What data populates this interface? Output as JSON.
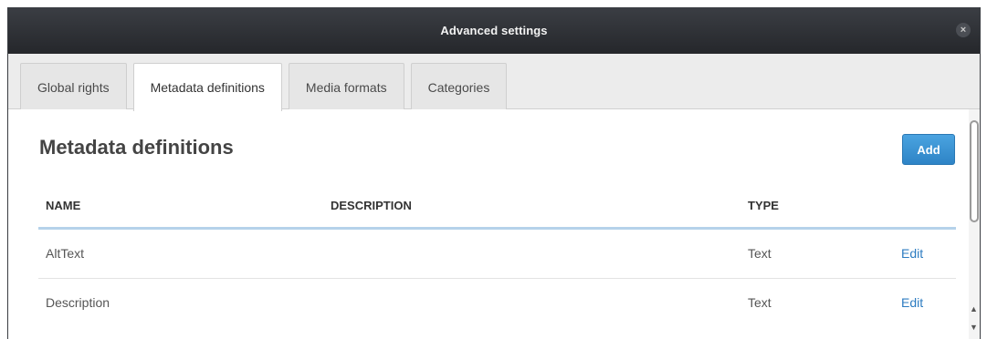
{
  "window": {
    "title": "Advanced settings",
    "close_symbol": "×"
  },
  "tabs": [
    {
      "label": "Global rights"
    },
    {
      "label": "Metadata definitions",
      "active": true
    },
    {
      "label": "Media formats"
    },
    {
      "label": "Categories"
    }
  ],
  "main": {
    "heading": "Metadata definitions",
    "add_label": "Add"
  },
  "table": {
    "columns": {
      "name": "NAME",
      "description": "DESCRIPTION",
      "type": "TYPE"
    },
    "rows": [
      {
        "name": "AltText",
        "description": "",
        "type": "Text",
        "action": "Edit"
      },
      {
        "name": "Description",
        "description": "",
        "type": "Text",
        "action": "Edit"
      }
    ]
  },
  "scrollbar": {
    "up_symbol": "▲",
    "down_symbol": "▼"
  },
  "colors": {
    "accent": "#2d7cc1",
    "titlebar": "#2b2d31",
    "header_rule": "#b5d2ea"
  }
}
